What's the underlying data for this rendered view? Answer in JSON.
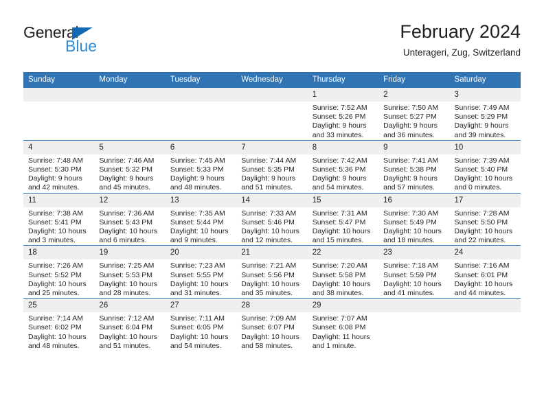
{
  "brand": {
    "name_dark": "General",
    "name_blue": "Blue",
    "triangle_color": "#1268b3",
    "blue_text_color": "#2e8bd4"
  },
  "header": {
    "title": "February 2024",
    "subtitle": "Unterageri, Zug, Switzerland"
  },
  "theme": {
    "header_blue": "#3074b4",
    "row_rule_blue": "#2f74b4",
    "daynum_band": "#efefef",
    "text": "#231f20"
  },
  "weekdays": [
    "Sunday",
    "Monday",
    "Tuesday",
    "Wednesday",
    "Thursday",
    "Friday",
    "Saturday"
  ],
  "weeks": [
    [
      {
        "day": "",
        "l1": "",
        "l2": "",
        "l3": "",
        "l4": ""
      },
      {
        "day": "",
        "l1": "",
        "l2": "",
        "l3": "",
        "l4": ""
      },
      {
        "day": "",
        "l1": "",
        "l2": "",
        "l3": "",
        "l4": ""
      },
      {
        "day": "",
        "l1": "",
        "l2": "",
        "l3": "",
        "l4": ""
      },
      {
        "day": "1",
        "l1": "Sunrise: 7:52 AM",
        "l2": "Sunset: 5:26 PM",
        "l3": "Daylight: 9 hours",
        "l4": "and 33 minutes."
      },
      {
        "day": "2",
        "l1": "Sunrise: 7:50 AM",
        "l2": "Sunset: 5:27 PM",
        "l3": "Daylight: 9 hours",
        "l4": "and 36 minutes."
      },
      {
        "day": "3",
        "l1": "Sunrise: 7:49 AM",
        "l2": "Sunset: 5:29 PM",
        "l3": "Daylight: 9 hours",
        "l4": "and 39 minutes."
      }
    ],
    [
      {
        "day": "4",
        "l1": "Sunrise: 7:48 AM",
        "l2": "Sunset: 5:30 PM",
        "l3": "Daylight: 9 hours",
        "l4": "and 42 minutes."
      },
      {
        "day": "5",
        "l1": "Sunrise: 7:46 AM",
        "l2": "Sunset: 5:32 PM",
        "l3": "Daylight: 9 hours",
        "l4": "and 45 minutes."
      },
      {
        "day": "6",
        "l1": "Sunrise: 7:45 AM",
        "l2": "Sunset: 5:33 PM",
        "l3": "Daylight: 9 hours",
        "l4": "and 48 minutes."
      },
      {
        "day": "7",
        "l1": "Sunrise: 7:44 AM",
        "l2": "Sunset: 5:35 PM",
        "l3": "Daylight: 9 hours",
        "l4": "and 51 minutes."
      },
      {
        "day": "8",
        "l1": "Sunrise: 7:42 AM",
        "l2": "Sunset: 5:36 PM",
        "l3": "Daylight: 9 hours",
        "l4": "and 54 minutes."
      },
      {
        "day": "9",
        "l1": "Sunrise: 7:41 AM",
        "l2": "Sunset: 5:38 PM",
        "l3": "Daylight: 9 hours",
        "l4": "and 57 minutes."
      },
      {
        "day": "10",
        "l1": "Sunrise: 7:39 AM",
        "l2": "Sunset: 5:40 PM",
        "l3": "Daylight: 10 hours",
        "l4": "and 0 minutes."
      }
    ],
    [
      {
        "day": "11",
        "l1": "Sunrise: 7:38 AM",
        "l2": "Sunset: 5:41 PM",
        "l3": "Daylight: 10 hours",
        "l4": "and 3 minutes."
      },
      {
        "day": "12",
        "l1": "Sunrise: 7:36 AM",
        "l2": "Sunset: 5:43 PM",
        "l3": "Daylight: 10 hours",
        "l4": "and 6 minutes."
      },
      {
        "day": "13",
        "l1": "Sunrise: 7:35 AM",
        "l2": "Sunset: 5:44 PM",
        "l3": "Daylight: 10 hours",
        "l4": "and 9 minutes."
      },
      {
        "day": "14",
        "l1": "Sunrise: 7:33 AM",
        "l2": "Sunset: 5:46 PM",
        "l3": "Daylight: 10 hours",
        "l4": "and 12 minutes."
      },
      {
        "day": "15",
        "l1": "Sunrise: 7:31 AM",
        "l2": "Sunset: 5:47 PM",
        "l3": "Daylight: 10 hours",
        "l4": "and 15 minutes."
      },
      {
        "day": "16",
        "l1": "Sunrise: 7:30 AM",
        "l2": "Sunset: 5:49 PM",
        "l3": "Daylight: 10 hours",
        "l4": "and 18 minutes."
      },
      {
        "day": "17",
        "l1": "Sunrise: 7:28 AM",
        "l2": "Sunset: 5:50 PM",
        "l3": "Daylight: 10 hours",
        "l4": "and 22 minutes."
      }
    ],
    [
      {
        "day": "18",
        "l1": "Sunrise: 7:26 AM",
        "l2": "Sunset: 5:52 PM",
        "l3": "Daylight: 10 hours",
        "l4": "and 25 minutes."
      },
      {
        "day": "19",
        "l1": "Sunrise: 7:25 AM",
        "l2": "Sunset: 5:53 PM",
        "l3": "Daylight: 10 hours",
        "l4": "and 28 minutes."
      },
      {
        "day": "20",
        "l1": "Sunrise: 7:23 AM",
        "l2": "Sunset: 5:55 PM",
        "l3": "Daylight: 10 hours",
        "l4": "and 31 minutes."
      },
      {
        "day": "21",
        "l1": "Sunrise: 7:21 AM",
        "l2": "Sunset: 5:56 PM",
        "l3": "Daylight: 10 hours",
        "l4": "and 35 minutes."
      },
      {
        "day": "22",
        "l1": "Sunrise: 7:20 AM",
        "l2": "Sunset: 5:58 PM",
        "l3": "Daylight: 10 hours",
        "l4": "and 38 minutes."
      },
      {
        "day": "23",
        "l1": "Sunrise: 7:18 AM",
        "l2": "Sunset: 5:59 PM",
        "l3": "Daylight: 10 hours",
        "l4": "and 41 minutes."
      },
      {
        "day": "24",
        "l1": "Sunrise: 7:16 AM",
        "l2": "Sunset: 6:01 PM",
        "l3": "Daylight: 10 hours",
        "l4": "and 44 minutes."
      }
    ],
    [
      {
        "day": "25",
        "l1": "Sunrise: 7:14 AM",
        "l2": "Sunset: 6:02 PM",
        "l3": "Daylight: 10 hours",
        "l4": "and 48 minutes."
      },
      {
        "day": "26",
        "l1": "Sunrise: 7:12 AM",
        "l2": "Sunset: 6:04 PM",
        "l3": "Daylight: 10 hours",
        "l4": "and 51 minutes."
      },
      {
        "day": "27",
        "l1": "Sunrise: 7:11 AM",
        "l2": "Sunset: 6:05 PM",
        "l3": "Daylight: 10 hours",
        "l4": "and 54 minutes."
      },
      {
        "day": "28",
        "l1": "Sunrise: 7:09 AM",
        "l2": "Sunset: 6:07 PM",
        "l3": "Daylight: 10 hours",
        "l4": "and 58 minutes."
      },
      {
        "day": "29",
        "l1": "Sunrise: 7:07 AM",
        "l2": "Sunset: 6:08 PM",
        "l3": "Daylight: 11 hours",
        "l4": "and 1 minute."
      },
      {
        "day": "",
        "l1": "",
        "l2": "",
        "l3": "",
        "l4": ""
      },
      {
        "day": "",
        "l1": "",
        "l2": "",
        "l3": "",
        "l4": ""
      }
    ]
  ]
}
